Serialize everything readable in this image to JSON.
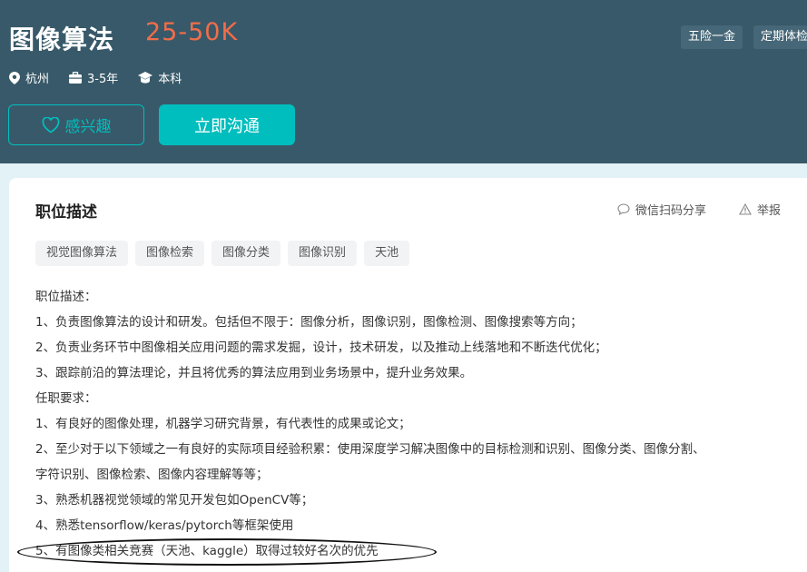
{
  "header": {
    "title": "图像算法",
    "salary": "25-50K",
    "benefits": [
      "五险一金",
      "定期体检"
    ],
    "meta": {
      "city": "杭州",
      "experience": "3-5年",
      "degree": "本科"
    },
    "interest_button": "感兴趣",
    "chat_button": "立即沟通"
  },
  "section": {
    "title": "职位描述",
    "share": "微信扫码分享",
    "report": "举报",
    "tags": [
      "视觉图像算法",
      "图像检索",
      "图像分类",
      "图像识别",
      "天池"
    ]
  },
  "description": [
    "职位描述：",
    "1、负责图像算法的设计和研发。包括但不限于：图像分析，图像识别，图像检测、图像搜索等方向；",
    "2、负责业务环节中图像相关应用问题的需求发掘，设计，技术研发，以及推动上线落地和不断迭代优化；",
    "3、跟踪前沿的算法理论，并且将优秀的算法应用到业务场景中，提升业务效果。",
    "任职要求：",
    "1、有良好的图像处理，机器学习研究背景，有代表性的成果或论文；",
    "2、至少对于以下领域之一有良好的实际项目经验积累：使用深度学习解决图像中的目标检测和识别、图像分类、图像分割、",
    "字符识别、图像检索、图像内容理解等等；",
    "3、熟悉机器视觉领域的常见开发包如OpenCV等；",
    "4、熟悉tensorflow/keras/pytorch等框架使用",
    "5、有图像类相关竞赛（天池、kaggle）取得过较好名次的优先"
  ],
  "colors": {
    "header_bg": "#385969",
    "accent": "#00bebd",
    "salary": "#f26d49"
  }
}
